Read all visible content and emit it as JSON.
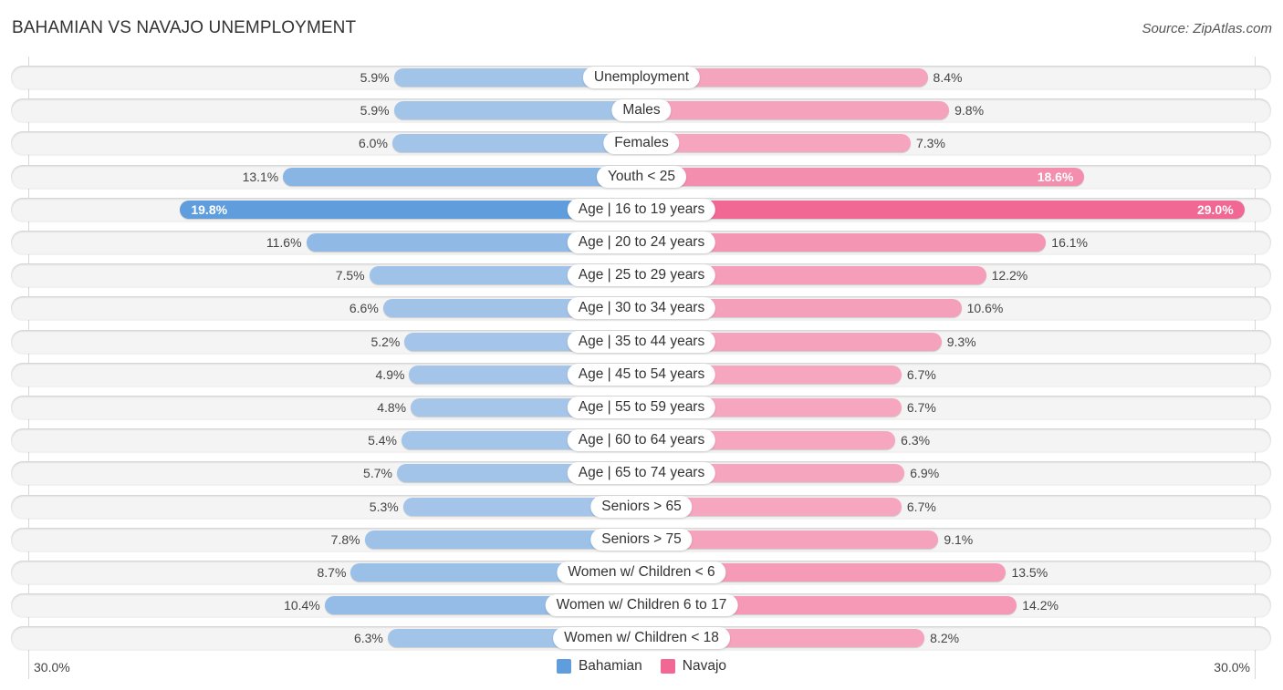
{
  "title": "BAHAMIAN VS NAVAJO UNEMPLOYMENT",
  "source": "Source: ZipAtlas.com",
  "chart_data": {
    "type": "bar",
    "orientation": "horizontal-diverging",
    "title": "BAHAMIAN VS NAVAJO UNEMPLOYMENT",
    "xlim": [
      0,
      30.0
    ],
    "x_tick_labels": {
      "left": "30.0%",
      "right": "30.0%"
    },
    "legend_position": "bottom-center",
    "categories": [
      "Unemployment",
      "Males",
      "Females",
      "Youth < 25",
      "Age | 16 to 19 years",
      "Age | 20 to 24 years",
      "Age | 25 to 29 years",
      "Age | 30 to 34 years",
      "Age | 35 to 44 years",
      "Age | 45 to 54 years",
      "Age | 55 to 59 years",
      "Age | 60 to 64 years",
      "Age | 65 to 74 years",
      "Seniors > 65",
      "Seniors > 75",
      "Women w/ Children < 6",
      "Women w/ Children 6 to 17",
      "Women w/ Children < 18"
    ],
    "series": [
      {
        "name": "Bahamian",
        "side": "left",
        "color": "#5f9ddc",
        "color_light": "#a9c8ea",
        "values": [
          5.9,
          5.9,
          6.0,
          13.1,
          19.8,
          11.6,
          7.5,
          6.6,
          5.2,
          4.9,
          4.8,
          5.4,
          5.7,
          5.3,
          7.8,
          8.7,
          10.4,
          6.3
        ],
        "labels": [
          "5.9%",
          "5.9%",
          "6.0%",
          "13.1%",
          "19.8%",
          "11.6%",
          "7.5%",
          "6.6%",
          "5.2%",
          "4.9%",
          "4.8%",
          "5.4%",
          "5.7%",
          "5.3%",
          "7.8%",
          "8.7%",
          "10.4%",
          "6.3%"
        ]
      },
      {
        "name": "Navajo",
        "side": "right",
        "color": "#f06893",
        "color_light": "#f6a9c1",
        "values": [
          8.4,
          9.8,
          7.3,
          18.6,
          29.0,
          16.1,
          12.2,
          10.6,
          9.3,
          6.7,
          6.7,
          6.3,
          6.9,
          6.7,
          9.1,
          13.5,
          14.2,
          8.2
        ],
        "labels": [
          "8.4%",
          "9.8%",
          "7.3%",
          "18.6%",
          "29.0%",
          "16.1%",
          "12.2%",
          "10.6%",
          "9.3%",
          "6.7%",
          "6.7%",
          "6.3%",
          "6.9%",
          "6.7%",
          "9.1%",
          "13.5%",
          "14.2%",
          "8.2%"
        ]
      }
    ]
  },
  "legend": [
    {
      "label": "Bahamian",
      "color": "#5f9ddc"
    },
    {
      "label": "Navajo",
      "color": "#f06893"
    }
  ]
}
